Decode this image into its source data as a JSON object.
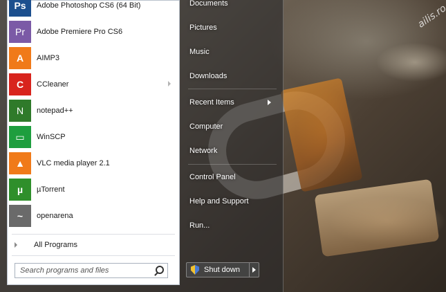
{
  "wallpaper": {
    "watermark": "ailis.ro"
  },
  "apps": [
    {
      "label": "Adobe Photoshop CS6 (64 Bit)",
      "icon": "photoshop-icon",
      "glyph": "Ps",
      "bg": "#1c4f8e",
      "submenu": false
    },
    {
      "label": "Adobe Premiere Pro CS6",
      "icon": "premiere-icon",
      "glyph": "Pr",
      "bg": "#7b5aa6",
      "submenu": false
    },
    {
      "label": "AIMP3",
      "icon": "aimp-icon",
      "glyph": "A",
      "bg": "#f07a19",
      "submenu": false
    },
    {
      "label": "CCleaner",
      "icon": "ccleaner-icon",
      "glyph": "C",
      "bg": "#d8241d",
      "submenu": true
    },
    {
      "label": "notepad++",
      "icon": "notepad-plus-plus-icon",
      "glyph": "N",
      "bg": "#2f7a2a",
      "submenu": false
    },
    {
      "label": "WinSCP",
      "icon": "winscp-icon",
      "glyph": "▭",
      "bg": "#1e9e3e",
      "submenu": false
    },
    {
      "label": "VLC media player 2.1",
      "icon": "vlc-icon",
      "glyph": "▲",
      "bg": "#f07a19",
      "submenu": false
    },
    {
      "label": "µTorrent",
      "icon": "utorrent-icon",
      "glyph": "µ",
      "bg": "#2f8f2b",
      "submenu": false
    },
    {
      "label": "openarena",
      "icon": "openarena-icon",
      "glyph": "~",
      "bg": "#6a6a6a",
      "submenu": false
    }
  ],
  "all_programs": "All Programs",
  "search": {
    "placeholder": "Search programs and files"
  },
  "places": {
    "documents": "Documents",
    "pictures": "Pictures",
    "music": "Music",
    "downloads": "Downloads",
    "recent_items": "Recent Items",
    "computer": "Computer",
    "network": "Network",
    "control_panel": "Control Panel",
    "help_and_support": "Help and Support",
    "run": "Run..."
  },
  "shutdown": {
    "label": "Shut down"
  }
}
